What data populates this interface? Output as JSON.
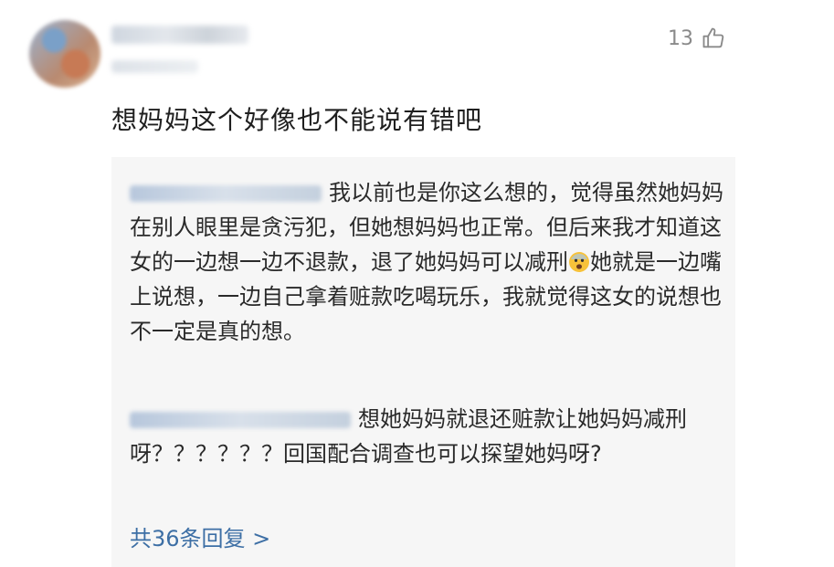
{
  "comment": {
    "like_count": "13",
    "text": "想妈妈这个好像也不能说有错吧"
  },
  "replies": [
    {
      "text": "我以前也是你这么想的，觉得虽然她妈妈在别人眼里是贪污犯，但她想妈妈也正常。但后来我才知道这女的一边想一边不退款，退了她妈妈可以减刑",
      "text_after_emoji": "她就是一边嘴上说想，一边自己拿着赃款吃喝玩乐，我就觉得这女的说想也不一定是真的想。",
      "emoji": "fearful-face-emoji"
    },
    {
      "text": "想她妈妈就退还赃款让她妈妈减刑呀？？？？？？回国配合调查也可以探望她妈呀?"
    }
  ],
  "more_replies": "共36条回复 >",
  "colors": {
    "link": "#3d6fa5",
    "reply_bg": "#f6f6f6",
    "muted": "#8a8a8a"
  }
}
